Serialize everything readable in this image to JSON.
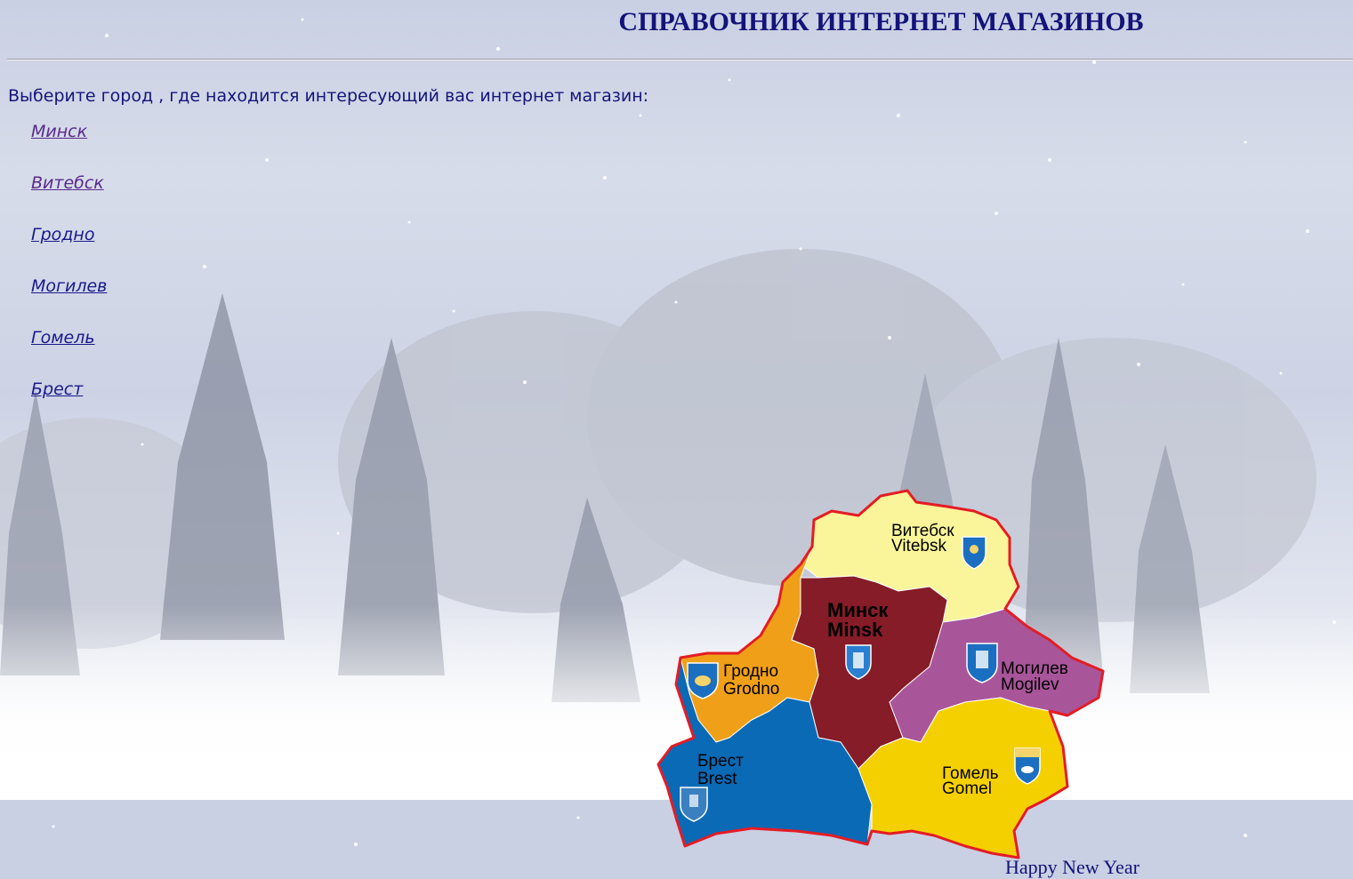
{
  "header": {
    "title": "СПРАВОЧНИК ИНТЕРНЕТ МАГАЗИНОВ"
  },
  "prompt": "Выберите город , где находится интересующий вас интернет магазин:",
  "cities": [
    {
      "label": "Минск",
      "visited": true
    },
    {
      "label": "Витебск",
      "visited": true
    },
    {
      "label": "Гродно",
      "visited": false
    },
    {
      "label": "Могилев",
      "visited": false
    },
    {
      "label": "Гомель",
      "visited": false
    },
    {
      "label": "Брест",
      "visited": false
    }
  ],
  "map": {
    "regions": {
      "vitebsk": {
        "ru": "Витебск",
        "en": "Vitebsk",
        "color": "#faf59a"
      },
      "minsk": {
        "ru": "Минск",
        "en": "Minsk",
        "color": "#861c28"
      },
      "grodno": {
        "ru": "Гродно",
        "en": "Grodno",
        "color": "#f0a018"
      },
      "mogilev": {
        "ru": "Могилев",
        "en": "Mogilev",
        "color": "#a8559a"
      },
      "brest": {
        "ru": "Брест",
        "en": "Brest",
        "color": "#0a6ab6"
      },
      "gomel": {
        "ru": "Гомель",
        "en": "Gomel",
        "color": "#f5d000"
      }
    },
    "border_color": "#e41c24"
  },
  "footer": {
    "text": "Happy New Year"
  },
  "colors": {
    "heading": "#13137a",
    "link": "#1a1a8c",
    "visited_link": "#5a2a8c"
  }
}
